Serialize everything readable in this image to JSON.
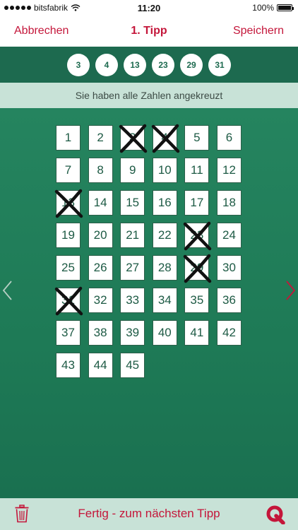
{
  "status": {
    "carrier": "bitsfabrik",
    "time": "11:20",
    "battery": "100%",
    "battery_level": 1.0
  },
  "nav": {
    "cancel_label": "Abbrechen",
    "title": "1. Tipp",
    "save_label": "Speichern"
  },
  "selected_numbers": [
    "3",
    "4",
    "13",
    "23",
    "29",
    "31"
  ],
  "info_text": "Sie haben alle Zahlen angekreuzt",
  "grid": {
    "numbers": [
      "1",
      "2",
      "3",
      "4",
      "5",
      "6",
      "7",
      "8",
      "9",
      "10",
      "11",
      "12",
      "13",
      "14",
      "15",
      "16",
      "17",
      "18",
      "19",
      "20",
      "21",
      "22",
      "23",
      "24",
      "25",
      "26",
      "27",
      "28",
      "29",
      "30",
      "31",
      "32",
      "33",
      "34",
      "35",
      "36",
      "37",
      "38",
      "39",
      "40",
      "41",
      "42",
      "43",
      "44",
      "45"
    ],
    "crossed": [
      "3",
      "4",
      "13",
      "23",
      "29",
      "31"
    ]
  },
  "icons": {
    "prev": "chevron-left-icon",
    "next": "chevron-right-icon",
    "trash": "trash-icon",
    "logo": "q-logo-icon",
    "wifi": "wifi-icon"
  },
  "bottom": {
    "done_label": "Fertig - zum nächsten Tipp"
  },
  "colors": {
    "accent": "#c4163a",
    "green_dark": "#1d6a4f",
    "green_light": "#c8e2d7"
  }
}
